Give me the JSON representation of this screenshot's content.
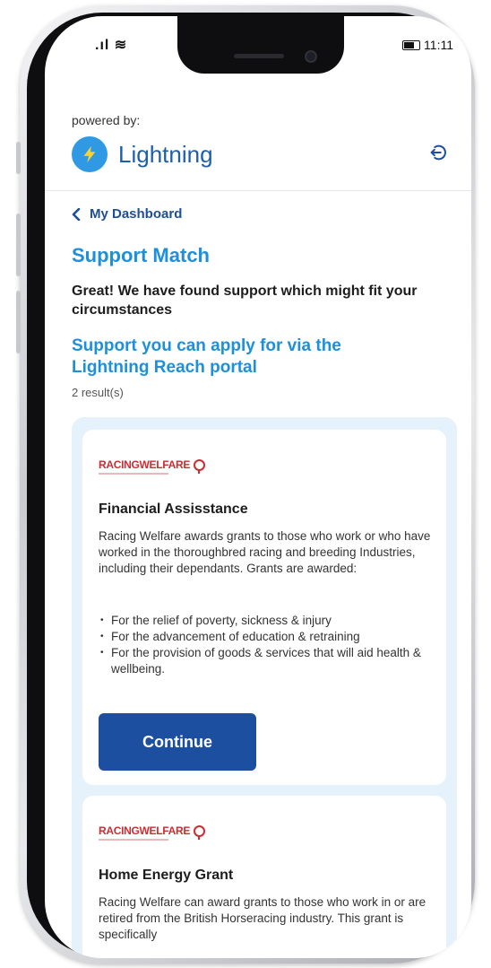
{
  "status": {
    "signal": ".ıl",
    "wifi": "≋",
    "time": "11:11"
  },
  "header": {
    "powered_by": "powered by:",
    "brand": "Lightning"
  },
  "nav": {
    "back_label": "My Dashboard"
  },
  "main": {
    "title": "Support Match",
    "intro": "Great! We have found support which might fit your circumstances",
    "section_title": "Support you can apply for via the Lightning Reach portal",
    "results_count": "2 result(s)"
  },
  "cards": [
    {
      "logo": "RACINGWELFARE",
      "title": "Financial Assisstance",
      "description": "Racing Welfare awards grants to those who work or who have worked in the thoroughbred racing and breeding Industries, including their dependants. Grants are awarded:",
      "bullets": [
        "For the relief of poverty, sickness & injury",
        "For the advancement of education & retraining",
        "For the provision of goods & services that will aid health & wellbeing."
      ],
      "button": "Continue"
    },
    {
      "logo": "RACINGWELFARE",
      "title": "Home Energy Grant",
      "description": "Racing Welfare can award grants to those who work in or are retired from the British Horseracing industry. This grant is specifically"
    }
  ],
  "colors": {
    "primary": "#1d4fa0",
    "accent": "#1e90da",
    "panel": "#e5f1fb",
    "logo_red": "#cc2d32"
  }
}
